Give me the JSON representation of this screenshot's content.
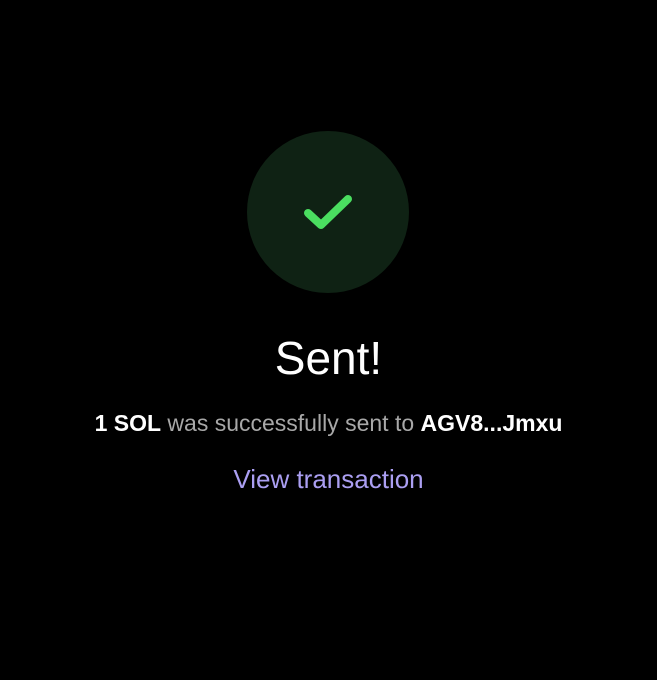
{
  "status": {
    "title": "Sent!",
    "amount": "1 SOL",
    "message_middle": "was successfully sent to",
    "recipient": "AGV8...Jmxu",
    "view_transaction_label": "View transaction"
  },
  "icons": {
    "success": "checkmark-icon"
  },
  "colors": {
    "background": "#000000",
    "success_circle": "#0f2214",
    "success_check": "#4ade60",
    "link": "#ab9ff2",
    "muted_text": "#a8a8a8"
  }
}
